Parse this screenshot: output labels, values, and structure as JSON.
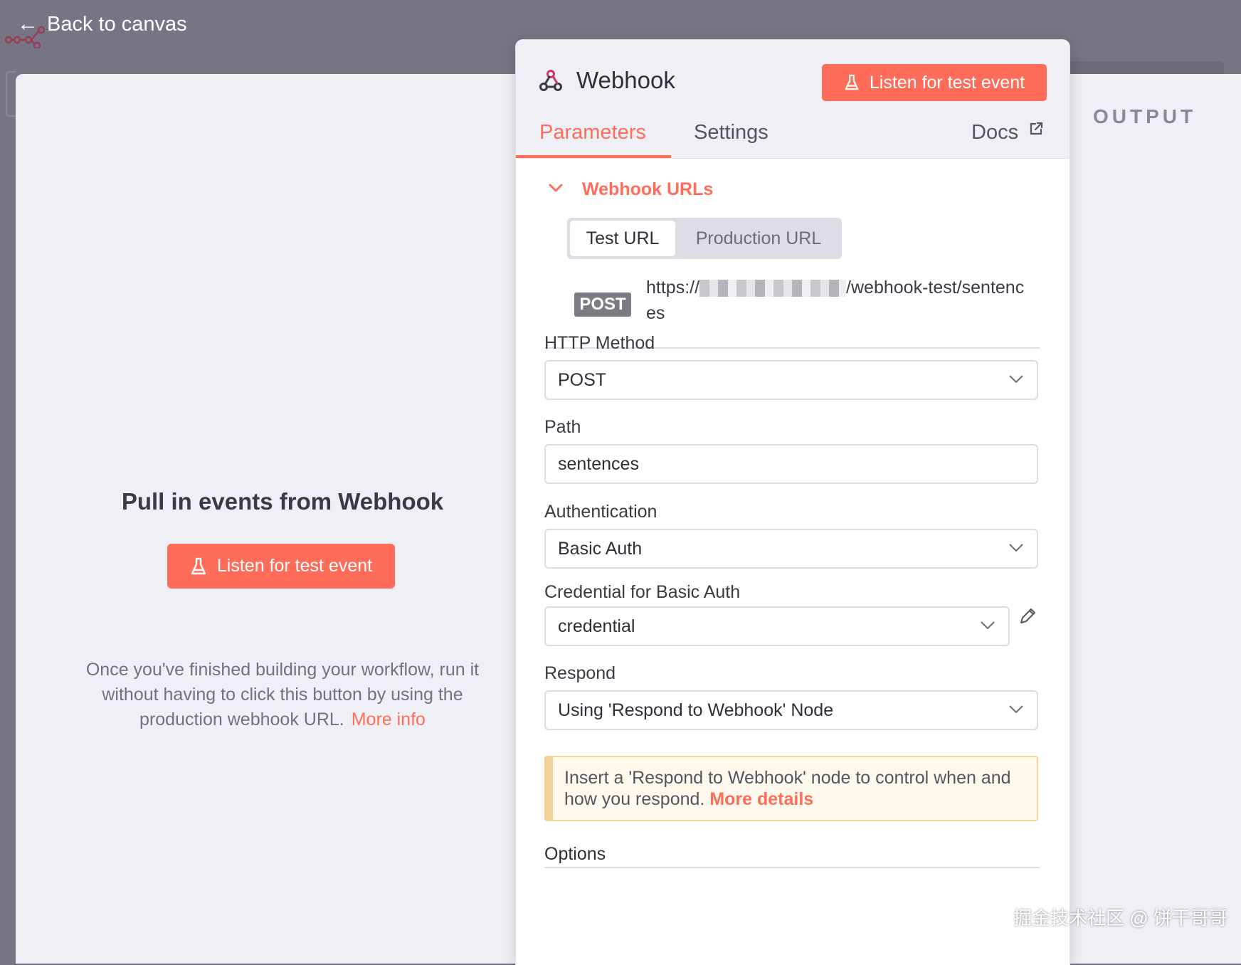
{
  "topbar": {
    "back_label": "Back to canvas"
  },
  "input_panel": {
    "title": "Pull in events from Webhook",
    "button_label": "Listen for test event",
    "description": "Once you've finished building your workflow, run it without having to click this button by using the production webhook URL.",
    "more_info_link": "More info"
  },
  "output_panel": {
    "label": "OUTPUT"
  },
  "node": {
    "title": "Webhook",
    "listen_button_label": "Listen for test event",
    "tabs": {
      "parameters": "Parameters",
      "settings": "Settings",
      "docs": "Docs"
    },
    "webhook_urls": {
      "section_title": "Webhook URLs",
      "toggle_test": "Test URL",
      "toggle_production": "Production URL",
      "method": "POST",
      "url_prefix": "https://",
      "url_suffix": "/webhook-test/sentences"
    },
    "fields": {
      "http_method": {
        "label": "HTTP Method",
        "value": "POST"
      },
      "path": {
        "label": "Path",
        "value": "sentences"
      },
      "authentication": {
        "label": "Authentication",
        "value": "Basic Auth"
      },
      "credential": {
        "label": "Credential for Basic Auth",
        "value": "credential"
      },
      "respond": {
        "label": "Respond",
        "value": "Using 'Respond to Webhook' Node"
      }
    },
    "notice": {
      "text": "Insert a 'Respond to Webhook' node to control when and how you respond.",
      "link": "More details"
    },
    "options_label": "Options"
  },
  "watermark": "掘金技术社区 @ 饼干哥哥",
  "colors": {
    "accent": "#ff6d5a",
    "notice_bg": "#fef9ec",
    "canvas_bg": "#757584"
  }
}
